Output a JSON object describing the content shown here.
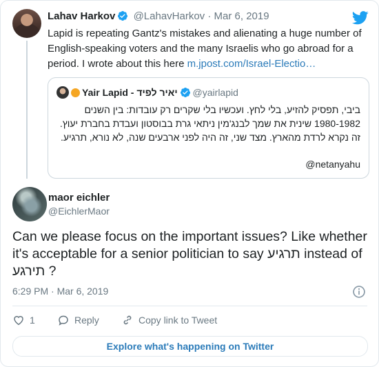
{
  "parent": {
    "name": "Lahav Harkov",
    "handle": "@LahavHarkov",
    "separator": "·",
    "date": "Mar 6, 2019",
    "text": "Lapid is repeating Gantz's mistakes and alienating a huge number of English-speaking voters and the many Israelis who go abroad for a period. I wrote about this here ",
    "link": "m.jpost.com/Israel-Electio…"
  },
  "quoted": {
    "name": "Yair Lapid - יאיר לפיד",
    "handle": "@yairlapid",
    "body": "ביבי, תפסיק להזיע, בלי לחץ. ועכשיו בלי שקרים רק עובדות: בין השנים 1980-1982 שינית את שמך לבנג'מין ניתאי גרת בבוסטון ועבדת בחברת יעוץ. זה נקרא לרדת מהארץ. מצד שני, זה היה לפני ארבעים שנה, לא נורא, תרגיע.",
    "mention": "@netanyahu"
  },
  "reply": {
    "name": "maor eichler",
    "handle": "@EichlerMaor",
    "text": "Can we please focus on the important issues? Like whether it's acceptable for a senior politician to say תרגיע instead of תירגע ?",
    "timestamp": "6:29 PM · Mar 6, 2019"
  },
  "actions": {
    "like_count": "1",
    "reply_label": "Reply",
    "copy_label": "Copy link to Tweet"
  },
  "footer": {
    "explore_label": "Explore what's happening on Twitter"
  },
  "colors": {
    "accent": "#1da1f2",
    "link": "#2b7bb9",
    "muted": "#697882",
    "text": "#1c2022",
    "border": "#e1e8ed"
  },
  "icons": [
    "verified-badge-icon",
    "twitter-bird-icon",
    "info-icon",
    "heart-icon",
    "reply-bubble-icon",
    "link-icon"
  ]
}
